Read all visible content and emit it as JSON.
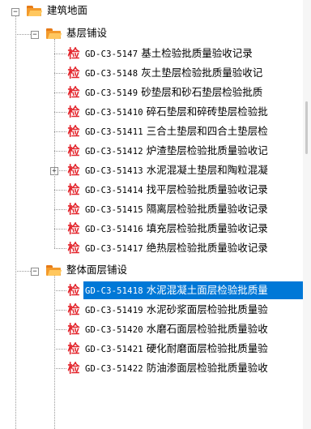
{
  "tree": {
    "root": {
      "label": "建筑地面",
      "expanded": true
    },
    "groups": [
      {
        "label": "基层铺设",
        "expanded": true,
        "items": [
          {
            "code": "GD-C3-5147",
            "title": "基土检验批质量验收记录"
          },
          {
            "code": "GD-C3-5148",
            "title": "灰土垫层检验批质量验收记"
          },
          {
            "code": "GD-C3-5149",
            "title": "砂垫层和砂石垫层检验批质"
          },
          {
            "code": "GD-C3-51410",
            "title": "碎石垫层和碎砖垫层检验批"
          },
          {
            "code": "GD-C3-51411",
            "title": "三合土垫层和四合土垫层检"
          },
          {
            "code": "GD-C3-51412",
            "title": "炉渣垫层检验批质量验收记"
          },
          {
            "code": "GD-C3-51413",
            "title": "水泥混凝土垫层和陶粒混凝",
            "expandable": true
          },
          {
            "code": "GD-C3-51414",
            "title": "找平层检验批质量验收记录"
          },
          {
            "code": "GD-C3-51415",
            "title": "隔离层检验批质量验收记录"
          },
          {
            "code": "GD-C3-51416",
            "title": "填充层检验批质量验收记录"
          },
          {
            "code": "GD-C3-51417",
            "title": "绝热层检验批质量验收记录"
          }
        ]
      },
      {
        "label": "整体面层铺设",
        "expanded": true,
        "items": [
          {
            "code": "GD-C3-51418",
            "title": "水泥混凝土面层检验批质量",
            "selected": true
          },
          {
            "code": "GD-C3-51419",
            "title": "水泥砂浆面层检验批质量验"
          },
          {
            "code": "GD-C3-51420",
            "title": "水磨石面层检验批质量验收"
          },
          {
            "code": "GD-C3-51421",
            "title": "硬化耐磨面层检验批质量验"
          },
          {
            "code": "GD-C3-51422",
            "title": "防油渗面层检验批质量验收"
          }
        ]
      }
    ],
    "item_icon_char": "检",
    "expand_char": "+",
    "collapse_char": "−",
    "icon_color": "#e3262d",
    "selection_color": "#0078d7"
  }
}
